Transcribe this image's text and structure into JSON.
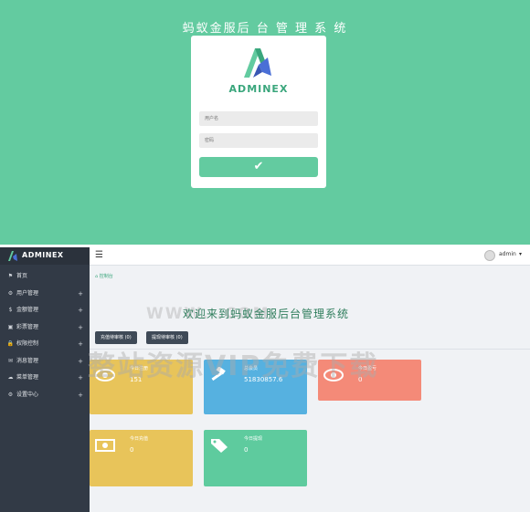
{
  "login": {
    "title": "蚂蚁金服后 台 管 理 系 统",
    "brand": "ADMINEX",
    "username_placeholder": "用户名",
    "password_placeholder": "密码",
    "submit_icon": "check-icon"
  },
  "admin": {
    "brand": "ADMINEX",
    "menu": [
      {
        "icon": "flag-icon",
        "label": "首页",
        "expandable": false
      },
      {
        "icon": "cog-icon",
        "label": "用户管理",
        "expandable": true
      },
      {
        "icon": "dollar-icon",
        "label": "金额管理",
        "expandable": true
      },
      {
        "icon": "picture-icon",
        "label": "彩票管理",
        "expandable": true
      },
      {
        "icon": "lock-icon",
        "label": "权限控制",
        "expandable": true
      },
      {
        "icon": "chat-icon",
        "label": "消息管理",
        "expandable": true
      },
      {
        "icon": "cloud-icon",
        "label": "菜单管理",
        "expandable": true
      },
      {
        "icon": "gear-icon",
        "label": "设置中心",
        "expandable": true
      }
    ],
    "plus": "+",
    "username": "admin",
    "breadcrumb": "控制台",
    "welcome": "欢迎来到蚂蚁金服后台管理系统",
    "buttons": [
      "充值待审核 (0)",
      "提现待审核 (0)"
    ],
    "cards": [
      {
        "label": "今日注册",
        "value": "151",
        "color": "#e8c45a",
        "icon": "eye-icon"
      },
      {
        "label": "总会员",
        "value": "51830857.6",
        "color": "#56b1e0",
        "icon": "gavel-icon"
      },
      {
        "label": "今日盈亏",
        "value": "0",
        "color": "#f48a78",
        "icon": "eye-icon"
      },
      {
        "label": "今日充值",
        "value": "0",
        "color": "#e8c45a",
        "icon": "money-icon"
      },
      {
        "label": "今日提现",
        "value": "0",
        "color": "#5ecb9e",
        "icon": "tag-icon"
      }
    ],
    "watermark_cn": "整站资源VIP免费下载",
    "watermark_en": "WWW.          .COM"
  }
}
